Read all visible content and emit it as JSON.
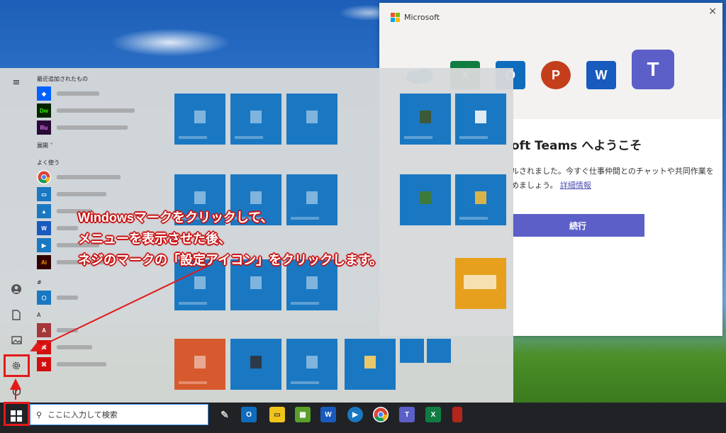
{
  "teams_window": {
    "brand": "Microsoft",
    "close_glyph": "×",
    "icons": [
      "X",
      "O",
      "P",
      "W",
      "T"
    ],
    "welcome_title": "oft Teams へようこそ",
    "description": "ルされました。今すぐ仕事仲間とのチャットや共同作業を",
    "description_line2": "めましょう。",
    "link": "詳細情報",
    "continue_button": "続行"
  },
  "start_menu": {
    "recent_header": "最近追加されたもの",
    "expand_label": "展開 ˅",
    "frequent_header": "よく使う",
    "hash_header": "#",
    "a_header": "A",
    "recent_icons": [
      "Dw",
      "Ru"
    ],
    "frequent_icons": [
      "W",
      "Ai"
    ],
    "a_icons": [
      "A"
    ]
  },
  "taskbar": {
    "search_placeholder": "ここに入力して検索",
    "search_icon_glyph": "⚲"
  },
  "annotation": {
    "line1_latin": "Windows",
    "line1_rest": "マークをクリックして、",
    "line2": "メニューを表示させた後、",
    "line3": "ネジのマークの「設定アイコン」をクリックします。"
  },
  "colors": {
    "accent_red": "#e21a1a",
    "teams_purple": "#5b5fc7",
    "tile_blue": "#1a78c2"
  }
}
